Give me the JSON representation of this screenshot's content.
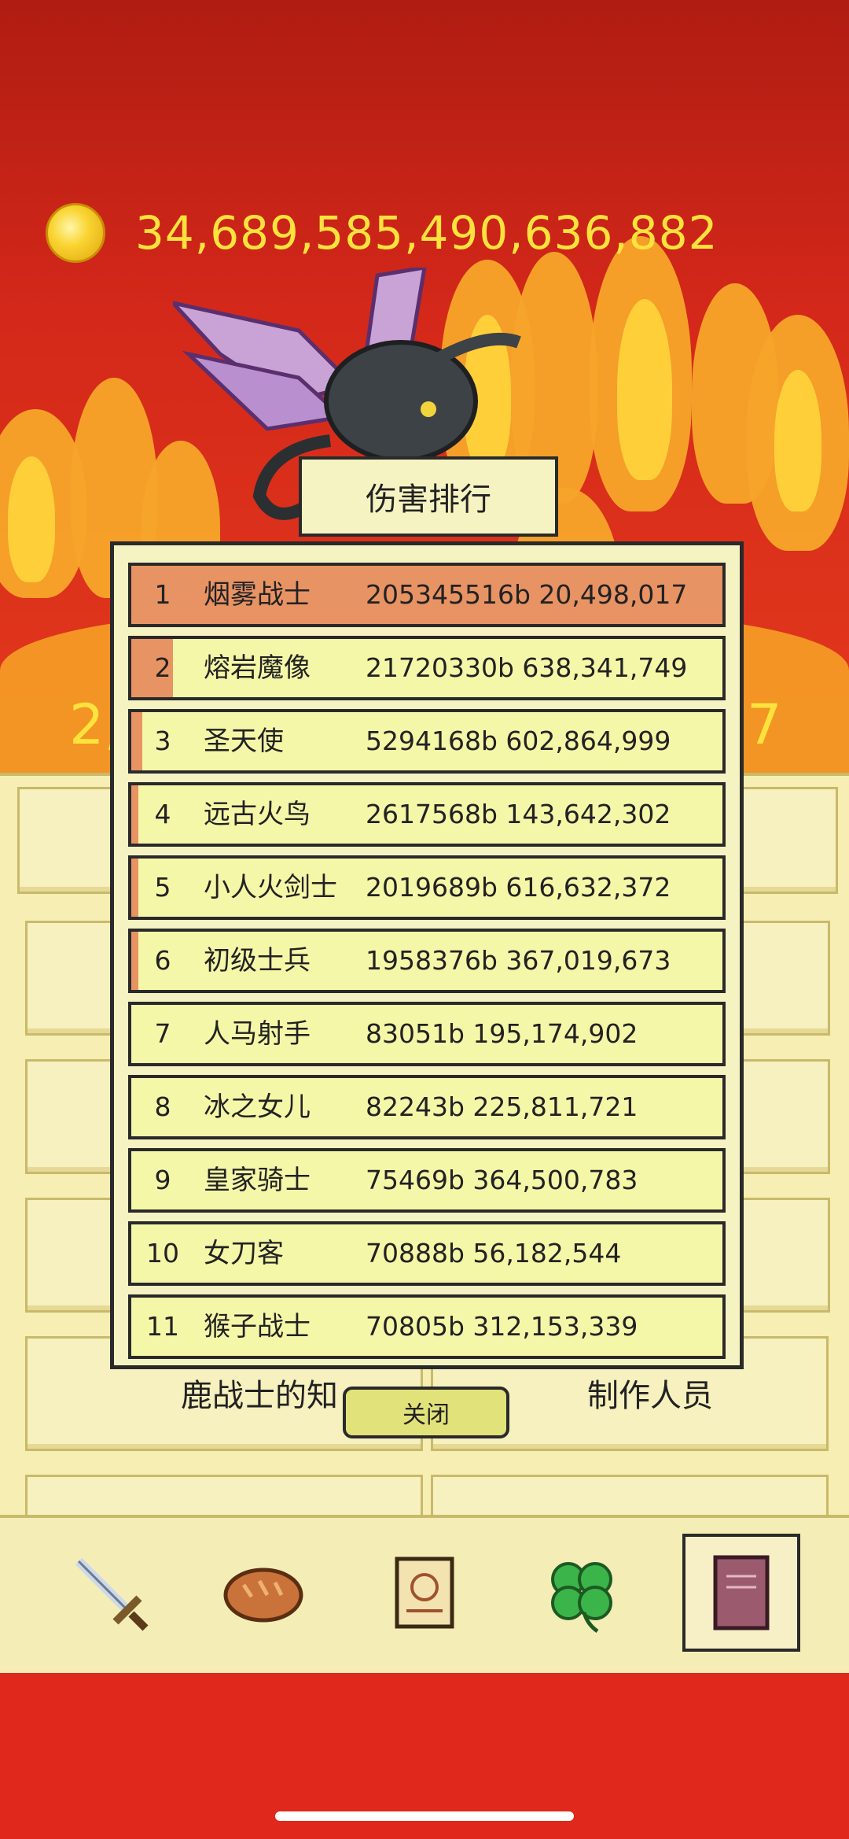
{
  "currency": {
    "icon": "gold-coin-icon",
    "amount": "34,689,585,490,636,882"
  },
  "side_numbers": {
    "left": "2,",
    "right": "7"
  },
  "monster": {
    "icon": "winged-demon-icon"
  },
  "ranking": {
    "title": "伤害排行",
    "close_label": "关闭",
    "rows": [
      {
        "rank": "1",
        "name": "烟雾战士",
        "value": "205345516b 20,498,017",
        "share": 1.0
      },
      {
        "rank": "2",
        "name": "熔岩魔像",
        "value": "21720330b 638,341,749",
        "share": 0.105
      },
      {
        "rank": "3",
        "name": "圣天使",
        "value": "5294168b 602,864,999",
        "share": 0.026
      },
      {
        "rank": "4",
        "name": "远古火鸟",
        "value": "2617568b 143,642,302",
        "share": 0.013
      },
      {
        "rank": "5",
        "name": "小人火剑士",
        "value": "2019689b 616,632,372",
        "share": 0.01
      },
      {
        "rank": "6",
        "name": "初级士兵",
        "value": "1958376b 367,019,673",
        "share": 0.01
      },
      {
        "rank": "7",
        "name": "人马射手",
        "value": "83051b 195,174,902",
        "share": 0.0
      },
      {
        "rank": "8",
        "name": "冰之女儿",
        "value": "82243b 225,811,721",
        "share": 0.0
      },
      {
        "rank": "9",
        "name": "皇家骑士",
        "value": "75469b 364,500,783",
        "share": 0.0
      },
      {
        "rank": "10",
        "name": "女刀客",
        "value": "70888b 56,182,544",
        "share": 0.0
      },
      {
        "rank": "11",
        "name": "猴子战士",
        "value": "70805b 312,153,339",
        "share": 0.0
      }
    ]
  },
  "menu": {
    "knowledge_label": "鹿战士的知",
    "credits_label": "制作人员"
  },
  "bottom_nav": [
    {
      "icon": "sword-icon"
    },
    {
      "icon": "bread-icon"
    },
    {
      "icon": "scroll-icon"
    },
    {
      "icon": "clover-icon"
    },
    {
      "icon": "book-icon"
    }
  ]
}
